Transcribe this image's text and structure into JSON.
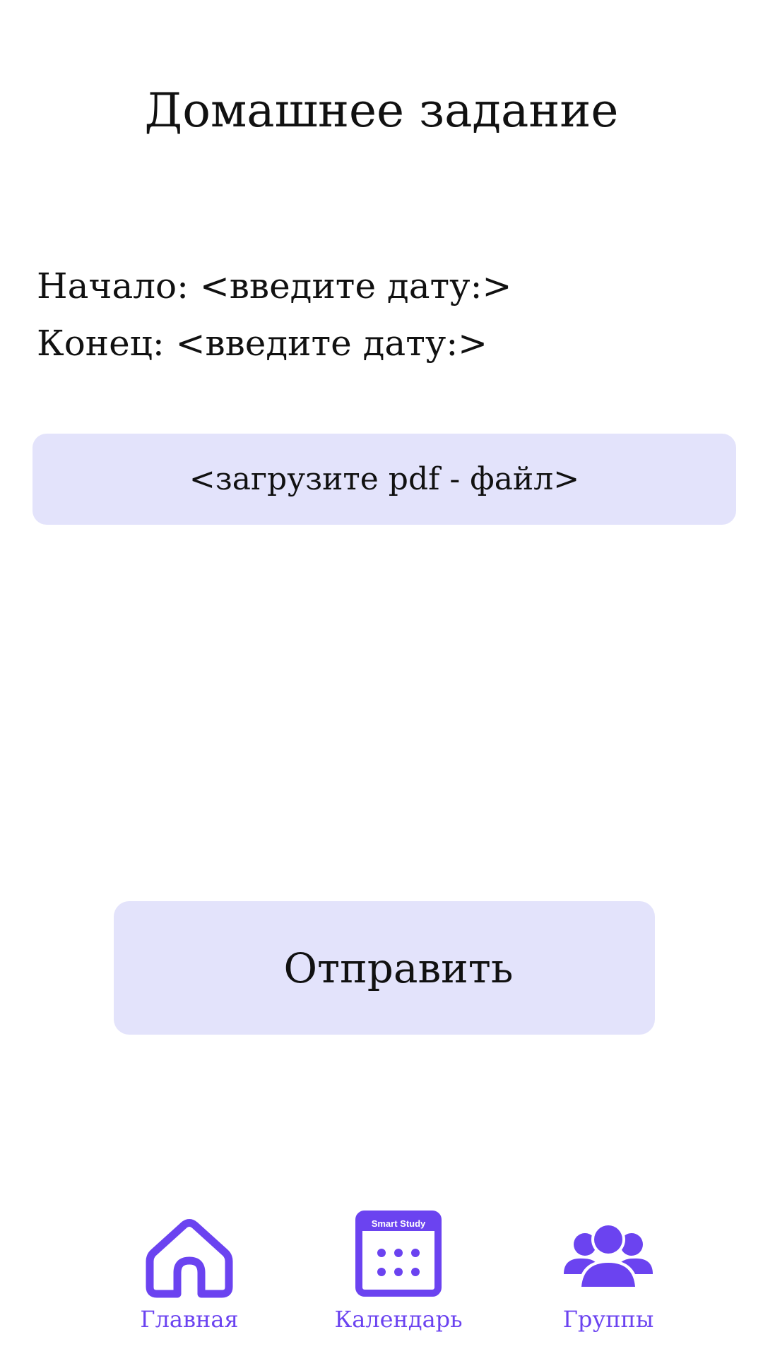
{
  "header": {
    "title": "Домашнее задание"
  },
  "form": {
    "start_label": "Начало: <введите дату:>",
    "end_label": "Конец: <введите дату:>",
    "upload_label": "<загрузите pdf - файл>",
    "submit_label": "Отправить"
  },
  "bottom_nav": {
    "items": [
      {
        "label": "Главная",
        "icon": "home-icon"
      },
      {
        "label": "Календарь",
        "icon": "calendar-icon",
        "icon_text": "Smart Study"
      },
      {
        "label": "Группы",
        "icon": "group-icon"
      }
    ]
  },
  "colors": {
    "accent": "#6b43f0",
    "button_background": "#e3e3fb",
    "text": "#111111",
    "background": "#ffffff"
  }
}
